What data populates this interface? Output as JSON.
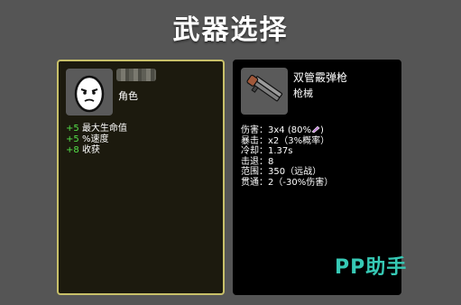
{
  "title": "武器选择",
  "character": {
    "sub_label": "角色",
    "stats": [
      {
        "bonus": "+5",
        "label": "最大生命值"
      },
      {
        "bonus": "+5",
        "label": "%速度"
      },
      {
        "bonus": "+8",
        "label": "收获"
      }
    ]
  },
  "weapon": {
    "name": "双管霰弹枪",
    "type": "枪械",
    "stats": [
      {
        "label": "伤害：",
        "value": "3x4 (80%"
      },
      {
        "label": "暴击：",
        "value": "x2（3%概率）"
      },
      {
        "label": "冷却：",
        "value": "1.37s"
      },
      {
        "label": "击退：",
        "value": "8"
      },
      {
        "label": "范围：",
        "value": "350（远战）"
      },
      {
        "label": "贯通：",
        "value": "2（-30%伤害）"
      }
    ],
    "damage_tail": ")"
  },
  "watermark": "PP助手",
  "colors": {
    "accent_border": "#c8c069",
    "positive": "#55e04a",
    "watermark": "#36c9b5"
  }
}
